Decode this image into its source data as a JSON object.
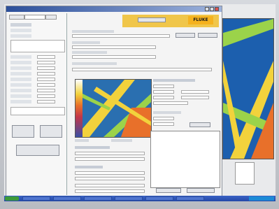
{
  "app": {
    "brand_logo": "FLUKE",
    "window_controls": [
      "minimize-icon",
      "maximize-icon",
      "close-icon"
    ]
  },
  "taskbar": {
    "start_label": "start",
    "items": 6
  },
  "colors": {
    "titlebar": "#2c4f9a",
    "brand_bar": "#f0c64a",
    "thermal_hot": "#f2d23c",
    "thermal_cold": "#1c5fae",
    "taskbar": "#2448a8"
  }
}
